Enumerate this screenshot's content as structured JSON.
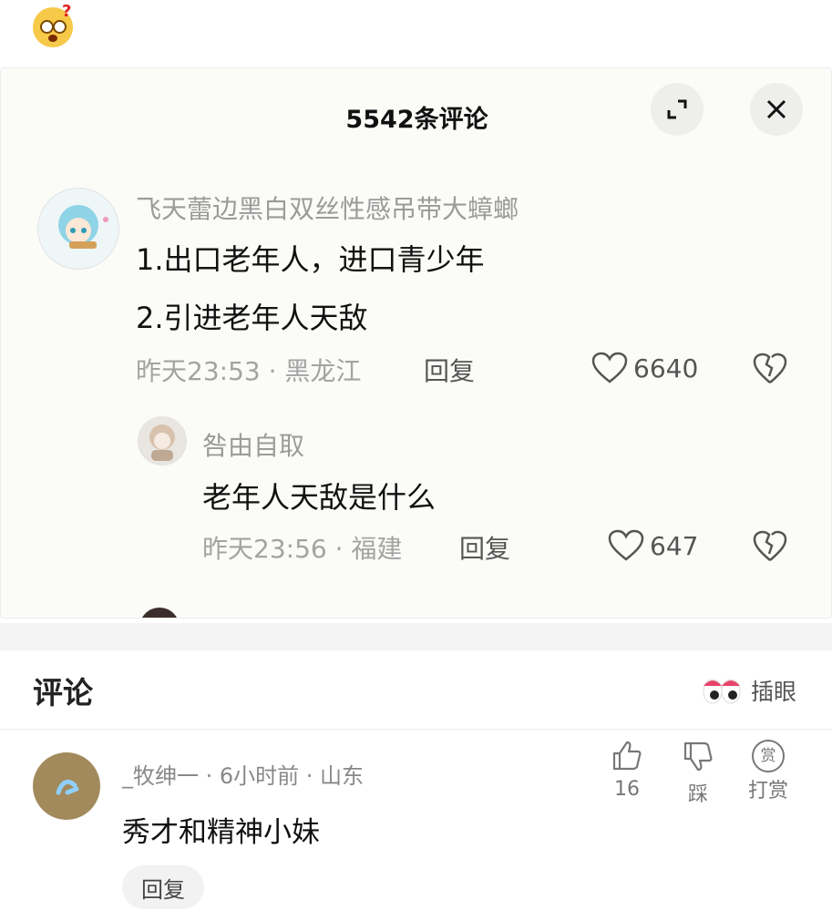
{
  "panel": {
    "title": "5542条评论",
    "comments": [
      {
        "user": "飞天蕾边黑白双丝性感吊带大蟑螂",
        "lines": [
          "1.出口老年人，进口青少年",
          "2.引进老年人天敌"
        ],
        "meta": "昨天23:53 · 黑龙江",
        "reply_label": "回复",
        "likes": "6640"
      },
      {
        "user": "咎由自取",
        "text": "老年人天敌是什么",
        "meta": "昨天23:56 · 福建",
        "reply_label": "回复",
        "likes": "647"
      }
    ]
  },
  "comments_section": {
    "title": "评论",
    "insert_label": "插眼",
    "item": {
      "meta": "_牧绅一 · 6小时前 · 山东",
      "text": "秀才和精神小妹",
      "like_count": "16",
      "dislike_label": "踩",
      "reward_label": "打赏",
      "reward_icon_glyph": "赏",
      "reply_label": "回复"
    }
  },
  "colors": {
    "panel_bg": "#fbfbf8",
    "muted_text": "#9b9b9b",
    "primary_text": "#111111"
  }
}
